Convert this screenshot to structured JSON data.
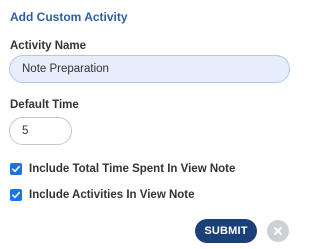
{
  "dialog": {
    "title": "Add Custom Activity"
  },
  "form": {
    "activity_name_label": "Activity Name",
    "activity_name_value": "Note Preparation",
    "default_time_label": "Default Time",
    "default_time_value": "5",
    "checkboxes": [
      {
        "label": "Include Total Time Spent In View Note",
        "checked": true
      },
      {
        "label": "Include Activities In View Note",
        "checked": true
      }
    ]
  },
  "actions": {
    "submit_label": "SUBMIT",
    "close_icon": "close-icon"
  },
  "colors": {
    "title": "#2e5fa3",
    "accent": "#1a73e8",
    "submit_bg": "#1b3f78",
    "name_input_bg": "#e6eefb",
    "close_bg": "#cdd0d4"
  }
}
